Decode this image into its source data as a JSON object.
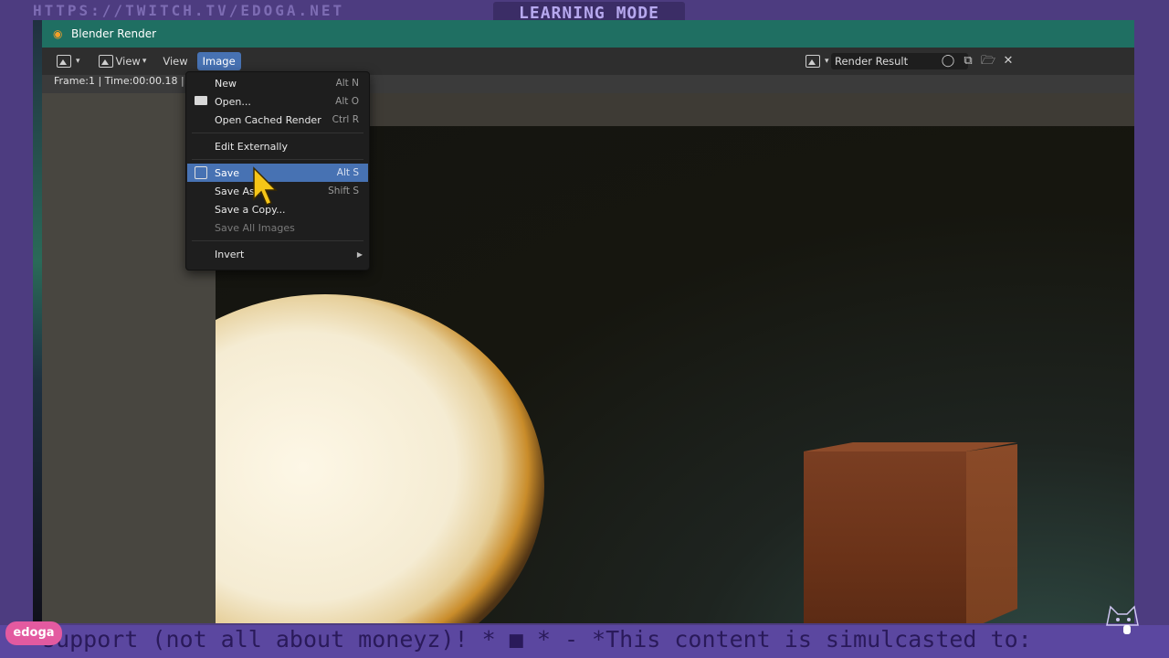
{
  "overlay": {
    "top_url": "HTTPS://TWITCH.TV/EDOGA.NET",
    "mode": "LEARNING MODE",
    "ticker": "support (not all about moneyz)!  * ■ * - *This content is simulcasted to:",
    "logo": "edoga"
  },
  "window": {
    "title": "Blender Render"
  },
  "header": {
    "view_label": "View",
    "view2_label": "View",
    "image_label": "Image",
    "image_field": "Render Result"
  },
  "info": {
    "frame": "Frame:1 | Time:00:00.18 | M"
  },
  "menu": {
    "items": [
      {
        "label": "New",
        "shortcut": "Alt N"
      },
      {
        "label": "Open...",
        "shortcut": "Alt O"
      },
      {
        "label": "Open Cached Render",
        "shortcut": "Ctrl R"
      },
      {
        "label": "Edit Externally",
        "shortcut": ""
      },
      {
        "label": "Save",
        "shortcut": "Alt S"
      },
      {
        "label": "Save As...",
        "shortcut": "Shift S"
      },
      {
        "label": "Save a Copy...",
        "shortcut": ""
      },
      {
        "label": "Save All Images",
        "shortcut": ""
      },
      {
        "label": "Invert",
        "shortcut": ""
      }
    ]
  },
  "colors": {
    "titlebar": "#1f6f62",
    "highlight": "#4772b3",
    "overlay": "#5b47a0"
  }
}
